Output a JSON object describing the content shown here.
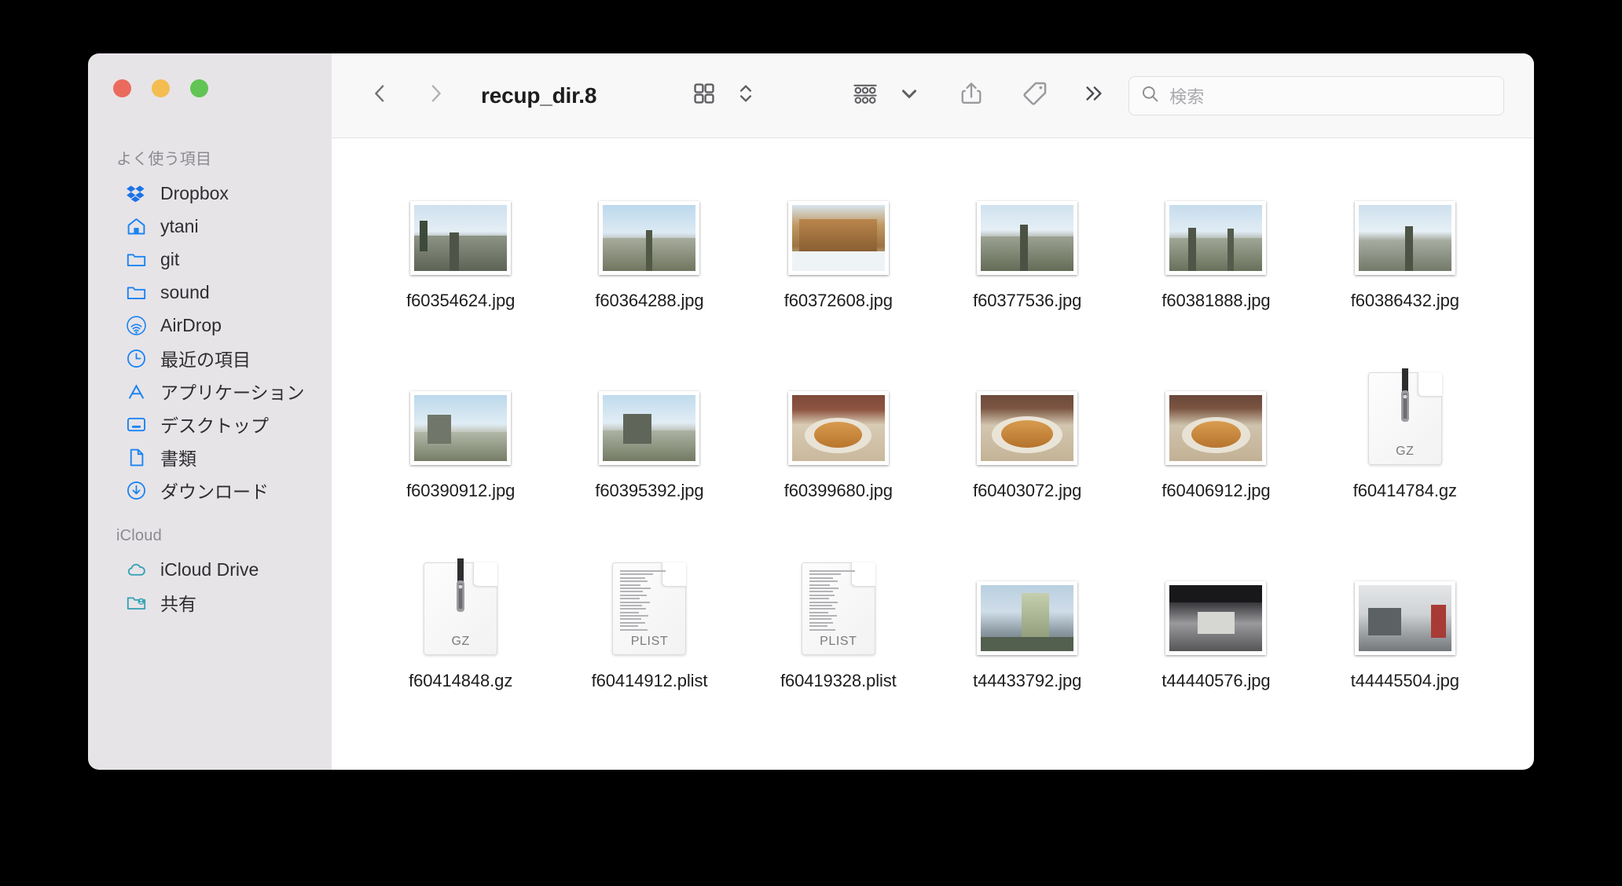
{
  "window": {
    "title": "recup_dir.8",
    "traffic_lights": [
      {
        "name": "close",
        "color": "#eb6a5e"
      },
      {
        "name": "minimize",
        "color": "#f4bd4f"
      },
      {
        "name": "maximize",
        "color": "#61c454"
      }
    ]
  },
  "toolbar": {
    "back_icon": "chevron-left-icon",
    "forward_icon": "chevron-right-icon",
    "view_icon": "grid-view-icon",
    "view_stepper_icon": "chevron-up-down-icon",
    "group_icon": "group-by-icon",
    "group_chevron_icon": "chevron-down-icon",
    "share_icon": "share-icon",
    "tag_icon": "tag-icon",
    "overflow_icon": "double-chevron-right-icon"
  },
  "search": {
    "placeholder": "検索",
    "value": "",
    "icon": "search-icon"
  },
  "sidebar": {
    "sections": [
      {
        "title": "よく使う項目",
        "items": [
          {
            "label": "Dropbox",
            "icon": "dropbox-icon",
            "tint": "#2e7ff0"
          },
          {
            "label": "ytani",
            "icon": "home-icon",
            "tint": "#1a84f2"
          },
          {
            "label": "git",
            "icon": "folder-icon",
            "tint": "#1a84f2"
          },
          {
            "label": "sound",
            "icon": "folder-icon",
            "tint": "#1a84f2"
          },
          {
            "label": "AirDrop",
            "icon": "airdrop-icon",
            "tint": "#1a84f2"
          },
          {
            "label": "最近の項目",
            "icon": "clock-icon",
            "tint": "#1a84f2"
          },
          {
            "label": "アプリケーション",
            "icon": "applications-icon",
            "tint": "#1a84f2"
          },
          {
            "label": "デスクトップ",
            "icon": "desktop-icon",
            "tint": "#1a84f2"
          },
          {
            "label": "書類",
            "icon": "document-icon",
            "tint": "#1a84f2"
          },
          {
            "label": "ダウンロード",
            "icon": "downloads-icon",
            "tint": "#1a84f2"
          }
        ]
      },
      {
        "title": "iCloud",
        "items": [
          {
            "label": "iCloud Drive",
            "icon": "cloud-icon",
            "tint": "#3aa3b5"
          },
          {
            "label": "共有",
            "icon": "shared-folder-icon",
            "tint": "#3aa3b5"
          }
        ]
      }
    ]
  },
  "files": [
    {
      "name": "f60354624.jpg",
      "kind": "photo",
      "theme": "snow-track"
    },
    {
      "name": "f60364288.jpg",
      "kind": "photo",
      "theme": "snow-track"
    },
    {
      "name": "f60372608.jpg",
      "kind": "photo",
      "theme": "cabin"
    },
    {
      "name": "f60377536.jpg",
      "kind": "photo",
      "theme": "snow-track"
    },
    {
      "name": "f60381888.jpg",
      "kind": "photo",
      "theme": "snow-track"
    },
    {
      "name": "f60386432.jpg",
      "kind": "photo",
      "theme": "snow-track"
    },
    {
      "name": "f60390912.jpg",
      "kind": "photo",
      "theme": "snow-station"
    },
    {
      "name": "f60395392.jpg",
      "kind": "photo",
      "theme": "snow-station"
    },
    {
      "name": "f60399680.jpg",
      "kind": "photo",
      "theme": "food"
    },
    {
      "name": "f60403072.jpg",
      "kind": "photo",
      "theme": "food"
    },
    {
      "name": "f60406912.jpg",
      "kind": "photo",
      "theme": "food"
    },
    {
      "name": "f60414784.gz",
      "kind": "gz",
      "badge": "GZ"
    },
    {
      "name": "f60414848.gz",
      "kind": "gz",
      "badge": "GZ"
    },
    {
      "name": "f60414912.plist",
      "kind": "plist",
      "badge": "PLIST"
    },
    {
      "name": "f60419328.plist",
      "kind": "plist",
      "badge": "PLIST"
    },
    {
      "name": "t44433792.jpg",
      "kind": "photo",
      "theme": "building"
    },
    {
      "name": "t44440576.jpg",
      "kind": "photo",
      "theme": "tunnel"
    },
    {
      "name": "t44445504.jpg",
      "kind": "photo",
      "theme": "street"
    },
    {
      "name": "",
      "kind": "photo-partial",
      "theme": "building"
    },
    {
      "name": "",
      "kind": "photo-partial",
      "theme": "tunnel"
    },
    {
      "name": "",
      "kind": "photo-partial",
      "theme": "street"
    },
    {
      "name": "",
      "kind": "photo-partial",
      "theme": "building"
    },
    {
      "name": "",
      "kind": "photo-partial",
      "theme": "building"
    },
    {
      "name": "",
      "kind": "photo-partial",
      "theme": "street"
    }
  ]
}
